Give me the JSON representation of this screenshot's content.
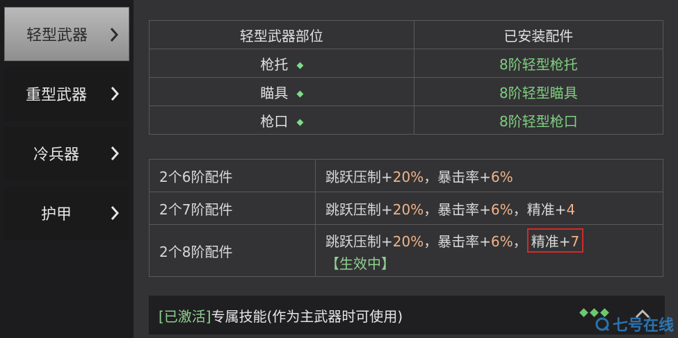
{
  "sidebar": {
    "items": [
      {
        "label": "轻型武器",
        "active": true
      },
      {
        "label": "重型武器",
        "active": false
      },
      {
        "label": "冷兵器",
        "active": false
      },
      {
        "label": "护甲",
        "active": false
      }
    ]
  },
  "parts_table": {
    "headers": [
      "轻型武器部位",
      "已安装配件"
    ],
    "rows": [
      {
        "slot": "枪托",
        "part": "8阶轻型枪托"
      },
      {
        "slot": "瞄具",
        "part": "8阶轻型瞄具"
      },
      {
        "slot": "枪口",
        "part": "8阶轻型枪口"
      }
    ]
  },
  "bonus_table": {
    "rows": [
      {
        "count": "2个6阶配件",
        "jump": "跳跃压制+",
        "jump_val": "20%",
        "sep1": "，暴击率+",
        "crit_val": "6%"
      },
      {
        "count": "2个7阶配件",
        "jump": "跳跃压制+",
        "jump_val": "20%",
        "sep1": "，暴击率+",
        "crit_val": "6%",
        "sep2": "，精准+",
        "acc_val": "4"
      },
      {
        "count": "2个8阶配件",
        "jump": "跳跃压制+",
        "jump_val": "20%",
        "sep1": "，暴击率+",
        "crit_val": "6%",
        "sep2": "，",
        "acc_text": "精准+",
        "acc_val": "7",
        "status": "【生效中】"
      }
    ]
  },
  "footer": {
    "tag": "[已激活]",
    "title": "专属技能(作为主武器时可使用)"
  },
  "watermark": {
    "text": "七号在线"
  },
  "colors": {
    "accent_green": "#8fd08f",
    "value_orange": "#f0b48a",
    "highlight_red": "#d42a2a"
  }
}
